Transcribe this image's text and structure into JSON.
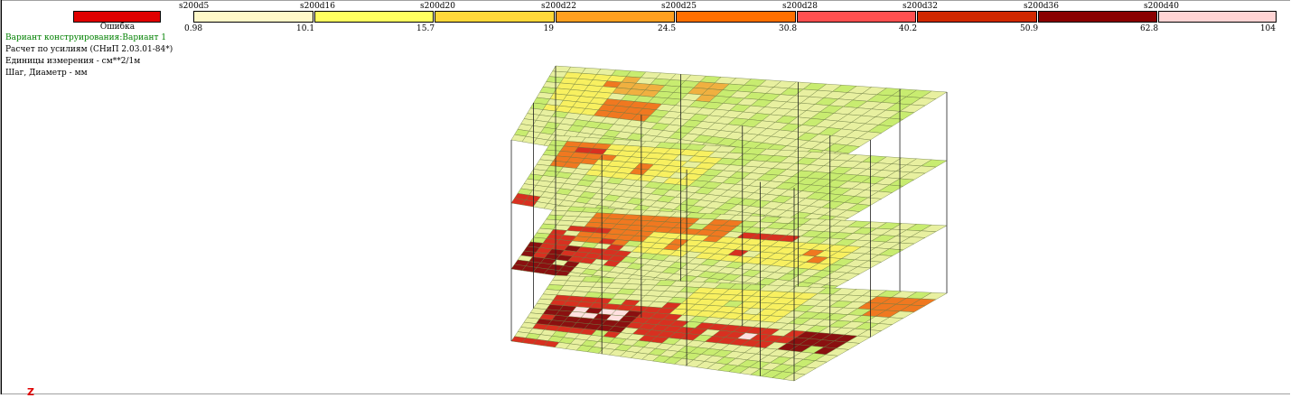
{
  "legend": {
    "error_label": "Ошибка",
    "error_color": "#e00000",
    "swatches": [
      {
        "label": "s200d5",
        "color": "#fff8c8"
      },
      {
        "label": "s200d16",
        "color": "#ffff60"
      },
      {
        "label": "s200d20",
        "color": "#ffd83a"
      },
      {
        "label": "s200d22",
        "color": "#ffa020"
      },
      {
        "label": "s200d25",
        "color": "#ff6f00"
      },
      {
        "label": "s200d28",
        "color": "#ff5050"
      },
      {
        "label": "s200d32",
        "color": "#d02800"
      },
      {
        "label": "s200d36",
        "color": "#8a0000"
      },
      {
        "label": "s200d40",
        "color": "#ffd4d4"
      }
    ],
    "ticks": [
      "0.98",
      "10.1",
      "15.7",
      "19",
      "24.5",
      "30.8",
      "40.2",
      "50.9",
      "62.8",
      "104"
    ]
  },
  "info": {
    "variant": "Вариант конструирования:Вариант 1",
    "calc": "Расчет по усилиям (СНиП 2.03.01-84*)",
    "units": "Единицы измерения - см**2/1м",
    "step": "Шаг, Диаметр - мм"
  },
  "axis_label": "Z",
  "mesh_colors": {
    "base": "#e8f0a0",
    "green": "#c8ec70",
    "yellow": "#f8f060",
    "amber": "#f0b040",
    "orange": "#f07820",
    "red": "#d83020",
    "darkred": "#8a1010",
    "pink": "#ffe0e0",
    "grid": "#6a7a40"
  },
  "floors": [
    {
      "name": "floor-4",
      "hotspots": [
        [
          0.08,
          0.15,
          0.35,
          0.55,
          "orange"
        ],
        [
          0.1,
          0.1,
          0.45,
          0.3,
          "amber"
        ],
        [
          0.02,
          0.05,
          0.18,
          0.6,
          "yellow"
        ],
        [
          0.3,
          0.1,
          0.4,
          0.35,
          "green"
        ]
      ]
    },
    {
      "name": "floor-3",
      "hotspots": [
        [
          0.05,
          0.1,
          0.35,
          0.45,
          "orange"
        ],
        [
          0.08,
          0.05,
          0.3,
          0.2,
          "red"
        ],
        [
          0.0,
          0.85,
          0.08,
          1.0,
          "red"
        ],
        [
          0.15,
          0.1,
          0.45,
          0.5,
          "yellow"
        ],
        [
          0.7,
          0.2,
          0.9,
          0.4,
          "green"
        ]
      ]
    },
    {
      "name": "floor-2",
      "hotspots": [
        [
          0.0,
          0.55,
          0.18,
          1.0,
          "darkred"
        ],
        [
          0.05,
          0.3,
          0.3,
          0.8,
          "red"
        ],
        [
          0.1,
          0.1,
          0.5,
          0.5,
          "orange"
        ],
        [
          0.55,
          0.2,
          0.7,
          0.55,
          "red"
        ],
        [
          0.75,
          0.35,
          0.85,
          0.55,
          "orange"
        ],
        [
          0.3,
          0.3,
          0.9,
          0.6,
          "yellow"
        ]
      ]
    },
    {
      "name": "floor-1",
      "hotspots": [
        [
          0.02,
          0.3,
          0.45,
          0.8,
          "red"
        ],
        [
          0.05,
          0.4,
          0.3,
          0.7,
          "darkred"
        ],
        [
          0.1,
          0.45,
          0.25,
          0.6,
          "pink"
        ],
        [
          0.45,
          0.5,
          0.9,
          0.7,
          "red"
        ],
        [
          0.62,
          0.55,
          0.7,
          0.65,
          "pink"
        ],
        [
          0.8,
          0.5,
          0.95,
          0.7,
          "darkred"
        ],
        [
          0.0,
          0.9,
          0.15,
          1.0,
          "red"
        ],
        [
          0.85,
          0.1,
          1.0,
          0.3,
          "orange"
        ],
        [
          0.4,
          0.1,
          0.7,
          0.45,
          "yellow"
        ]
      ]
    }
  ]
}
